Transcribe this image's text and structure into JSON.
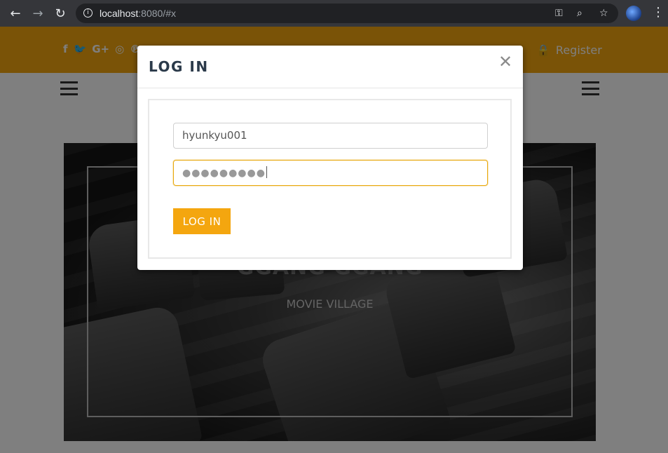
{
  "browser": {
    "url_host": "localhost",
    "url_rest": ":8080/#x"
  },
  "header": {
    "social_icons": [
      "facebook-icon",
      "twitter-icon",
      "google-plus-icon",
      "instagram-icon",
      "pinterest-icon"
    ],
    "social_glyphs": [
      "f",
      "🐦",
      "G+",
      "◎",
      "℗"
    ],
    "register_label": "Register",
    "accent_color": "#f4a60f"
  },
  "hero": {
    "title": "GGANG GGANG",
    "subtitle": "MOVIE VILLAGE"
  },
  "modal": {
    "title": "LOG IN",
    "username_value": "hyunkyu001",
    "password_mask": "●●●●●●●●●",
    "submit_label": "LOG IN"
  }
}
